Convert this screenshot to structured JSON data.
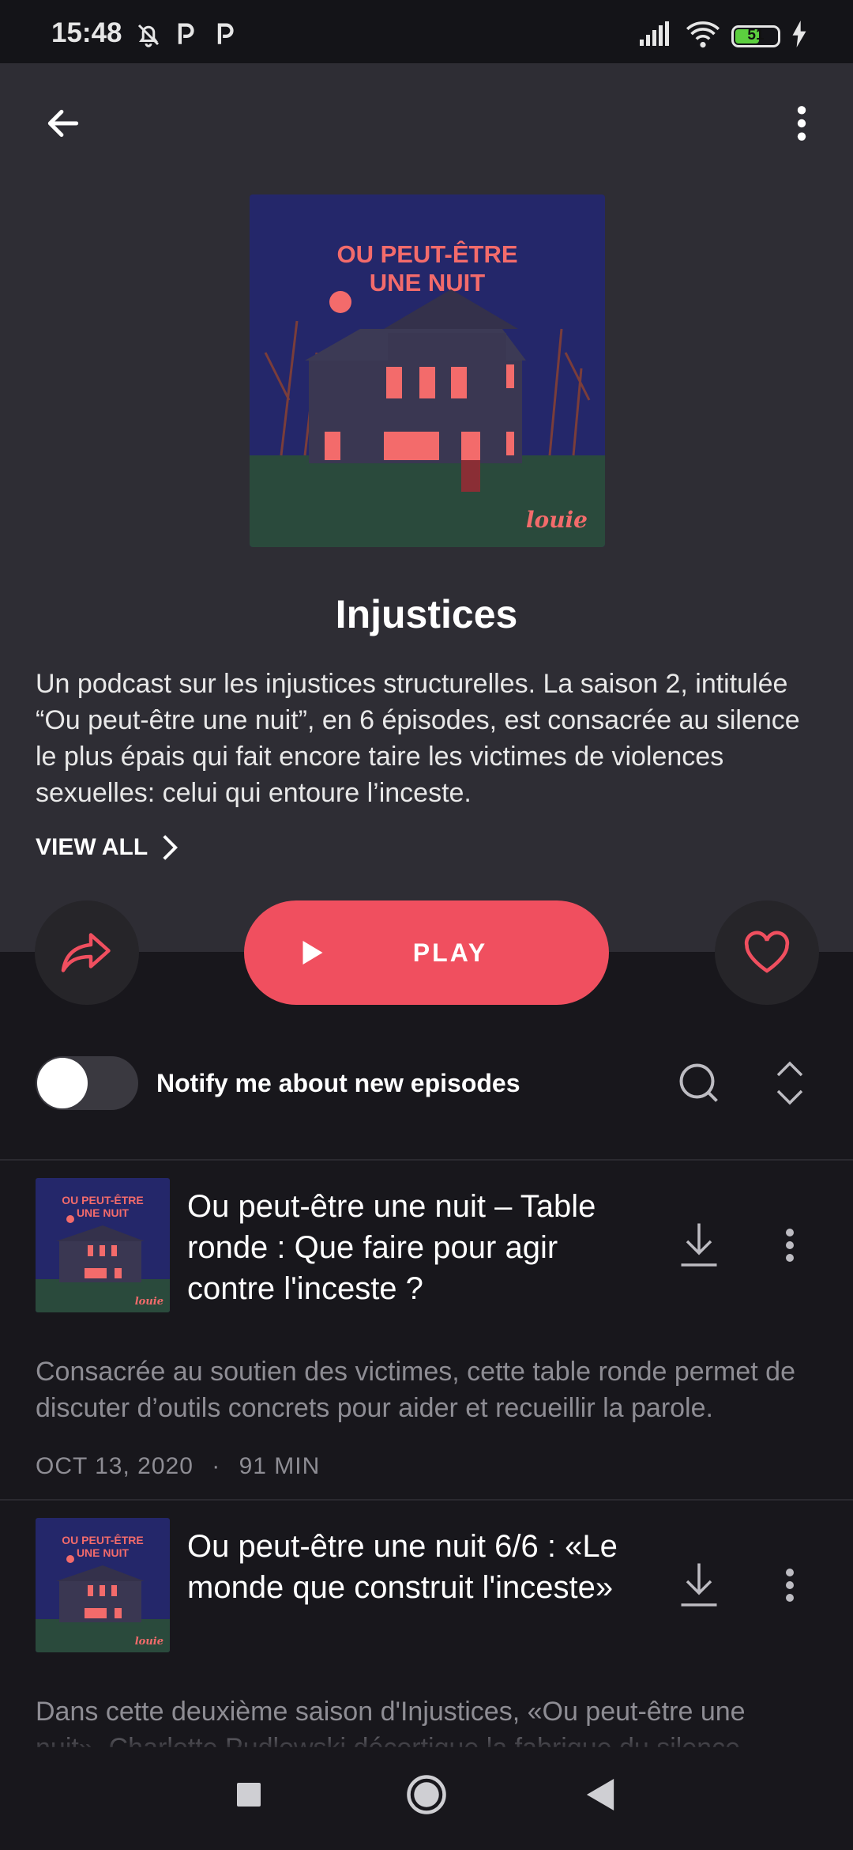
{
  "status_bar": {
    "time": "15:48",
    "battery": "51"
  },
  "podcast": {
    "cover_title": "OU PEUT-ÊTRE UNE NUIT",
    "cover_brand": "louie",
    "title": "Injustices",
    "description": "Un podcast sur les injustices structurelles. La saison 2, intitulée “Ou peut-être une nuit”, en 6 épisodes, est consacrée au silence le plus épais qui fait encore taire les victimes de violences sexuelles: celui qui entoure l’inceste.",
    "view_all_label": "VIEW ALL"
  },
  "actions": {
    "play_label": "PLAY"
  },
  "notify": {
    "label": "Notify me about new episodes",
    "enabled": false
  },
  "episodes": [
    {
      "thumb_title": "OU PEUT-ÊTRE UNE NUIT",
      "thumb_brand": "louie",
      "title": "Ou peut-être une nuit – Table ronde : Que faire pour agir contre l'inceste ?",
      "description": "Consacrée au soutien des victimes, cette table ronde permet de discuter d’outils concrets pour aider et recueillir la parole.",
      "date": "OCT 13, 2020",
      "separator": "·",
      "duration": "91 MIN"
    },
    {
      "thumb_title": "OU PEUT-ÊTRE UNE NUIT",
      "thumb_brand": "louie",
      "title": "Ou peut-être une nuit 6/6 : «Le monde que construit l'inceste»",
      "description": "Dans cette deuxième saison d'Injustices, «Ou peut-être une nuit», Charlotte Pudlowski décortique la fabrique du silence."
    }
  ],
  "colors": {
    "accent": "#f04f5f",
    "hero_bg": "#2e2d34",
    "page_bg": "#18171c",
    "cover_bg": "#24276a",
    "cover_text": "#f36b6b"
  },
  "icons": [
    "back-arrow-icon",
    "more-vert-icon",
    "share-icon",
    "play-icon",
    "heart-icon",
    "search-icon",
    "expand-collapse-icon",
    "download-icon",
    "chevron-right-icon",
    "stop-nav-icon",
    "home-nav-icon",
    "back-nav-icon"
  ]
}
